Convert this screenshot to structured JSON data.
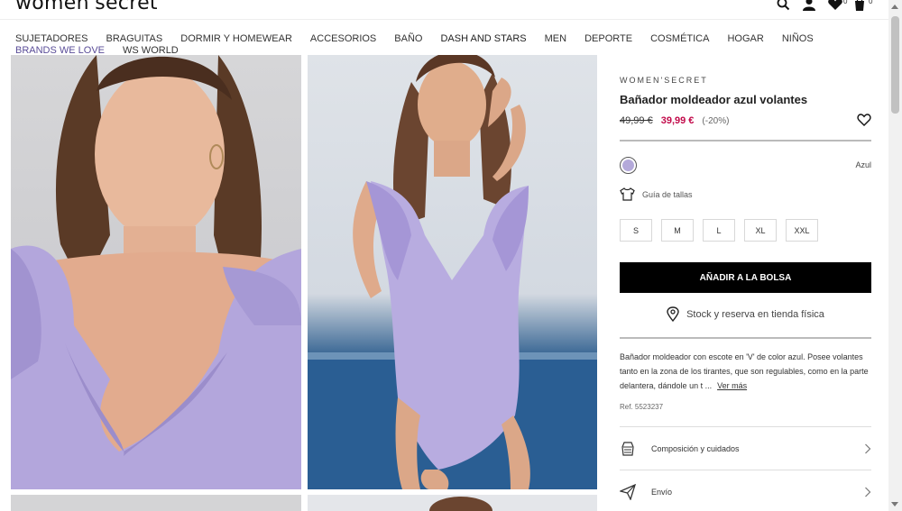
{
  "header": {
    "logo": "women'secret",
    "wishlist_count": "0",
    "cart_count": "0"
  },
  "nav": {
    "items": [
      "SUJETADORES",
      "BRAGUITAS",
      "DORMIR Y HOMEWEAR",
      "ACCESORIOS",
      "BAÑO",
      "DASH AND STARS",
      "MEN",
      "DEPORTE",
      "COSMÉTICA",
      "HOGAR",
      "NIÑOS",
      "BRANDS WE LOVE",
      "WS WORLD"
    ]
  },
  "product": {
    "brand": "WOMEN'SECRET",
    "title": "Bañador moldeador azul volantes",
    "old_price": "49,99 €",
    "new_price": "39,99 €",
    "discount": "(-20%)",
    "color_name": "Azul",
    "swatch_color": "#b4a9da",
    "size_guide": "Guía de tallas",
    "sizes": [
      "S",
      "M",
      "L",
      "XL",
      "XXL"
    ],
    "add_to_bag": "AÑADIR A LA BOLSA",
    "stock_reserve": "Stock y reserva en tienda física",
    "description": "Bañador moldeador con escote en 'V' de color azul. Posee volantes tanto en la zona de los tirantes, que son regulables, como en la parte delantera, dándole un t ...",
    "see_more": "Ver más",
    "ref": "Ref. 5523237"
  },
  "accordion": {
    "composition": "Composición y cuidados",
    "shipping": "Envío"
  },
  "colors": {
    "sale_price": "#c20a4a",
    "accent_nav": "#5a4d98",
    "button_bg": "#000000"
  }
}
